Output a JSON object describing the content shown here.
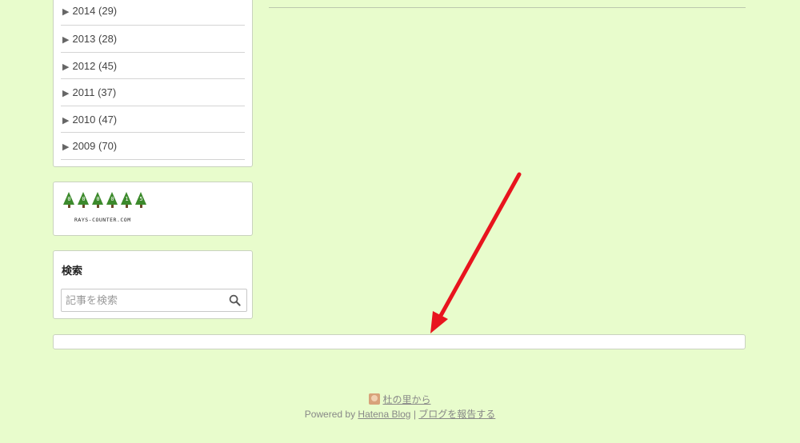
{
  "archive": {
    "items": [
      {
        "year": "2014",
        "count": "(29)"
      },
      {
        "year": "2013",
        "count": "(28)"
      },
      {
        "year": "2012",
        "count": "(45)"
      },
      {
        "year": "2011",
        "count": "(37)"
      },
      {
        "year": "2010",
        "count": "(47)"
      },
      {
        "year": "2009",
        "count": "(70)"
      }
    ],
    "expand_icon": "triangle-right-icon"
  },
  "counter": {
    "digits": [
      "0",
      "0",
      "0",
      "0",
      "1",
      "5"
    ],
    "credit": "RAYS-COUNTER.COM",
    "tree_color": "#3c8a2c"
  },
  "search": {
    "title": "検索",
    "placeholder": "記事を検索",
    "icon": "search-icon"
  },
  "footer": {
    "blog_name": "杜の里から",
    "powered_prefix": "Powered by",
    "hatena_link": "Hatena Blog",
    "separator": "|",
    "report_link": "ブログを報告する"
  },
  "annotation": {
    "color": "#e8141e",
    "icon": "red-arrow-icon"
  },
  "colors": {
    "background": "#e8fccc",
    "panel": "#ffffff"
  }
}
